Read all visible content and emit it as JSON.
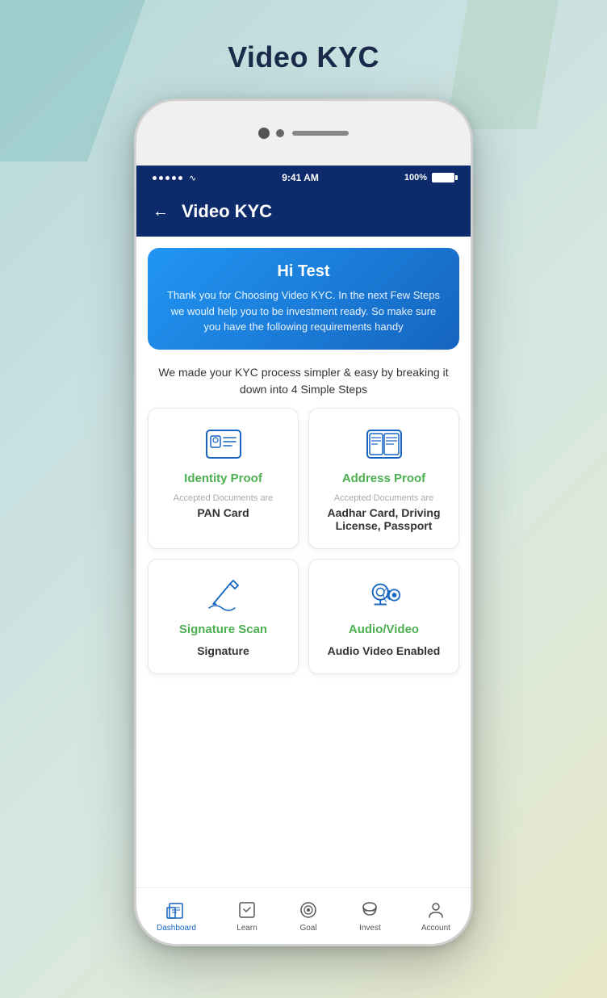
{
  "page": {
    "title": "Video KYC"
  },
  "status_bar": {
    "time": "9:41 AM",
    "battery": "100%"
  },
  "header": {
    "back_label": "←",
    "title": "Video KYC"
  },
  "banner": {
    "greeting": "Hi Test",
    "description": "Thank you for Choosing Video KYC. In the next Few Steps we would help you to be investment ready. So make sure you have the following requirements handy"
  },
  "steps_description": "We made your KYC process simpler & easy by breaking it down into 4 Simple Steps",
  "cards": [
    {
      "id": "identity-proof",
      "title": "Identity Proof",
      "docs_label": "Accepted Documents are",
      "docs_value": "PAN Card",
      "icon": "id-card"
    },
    {
      "id": "address-proof",
      "title": "Address Proof",
      "docs_label": "Accepted Documents are",
      "docs_value": "Aadhar Card, Driving License, Passport",
      "icon": "address-card"
    },
    {
      "id": "signature-scan",
      "title": "Signature Scan",
      "docs_label": "",
      "docs_value": "Signature",
      "icon": "signature"
    },
    {
      "id": "audio-video",
      "title": "Audio/Video",
      "docs_label": "",
      "docs_value": "Audio Video Enabled",
      "icon": "video"
    }
  ],
  "bottom_nav": [
    {
      "id": "dashboard",
      "label": "Dashboard",
      "active": true
    },
    {
      "id": "learn",
      "label": "Learn",
      "active": false
    },
    {
      "id": "goal",
      "label": "Goal",
      "active": false
    },
    {
      "id": "invest",
      "label": "Invest",
      "active": false
    },
    {
      "id": "account",
      "label": "Account",
      "active": false
    }
  ]
}
